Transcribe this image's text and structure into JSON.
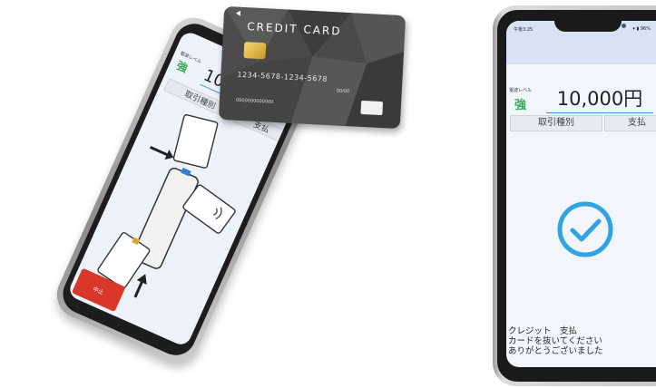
{
  "card": {
    "title": "CREDIT CARD",
    "number": "1234-5678-1234-5678",
    "expiry": "00/00",
    "name": "0000000000000"
  },
  "left_phone": {
    "level_label": "電波レベル",
    "strength": "強",
    "amount": "10,",
    "transaction_type": "取引種別",
    "payment_method": "支払",
    "cancel_button": "中止"
  },
  "right_phone": {
    "status_time": "午後3:25",
    "status_battery": "96%",
    "level_label": "電波レベル",
    "strength": "強",
    "amount": "10,000円",
    "transaction_type": "取引種別",
    "payment_method": "支払",
    "message_lines": [
      "クレジット　支払",
      "カードを抜いてください",
      "ありがとうございました"
    ]
  },
  "colors": {
    "accent": "#4a90d9",
    "check": "#2fa3e3",
    "signal_strength": "#34a853",
    "cancel_button": "#d9372a"
  },
  "icons": {
    "success": "check-circle-icon",
    "contactless": "contactless-icon"
  }
}
